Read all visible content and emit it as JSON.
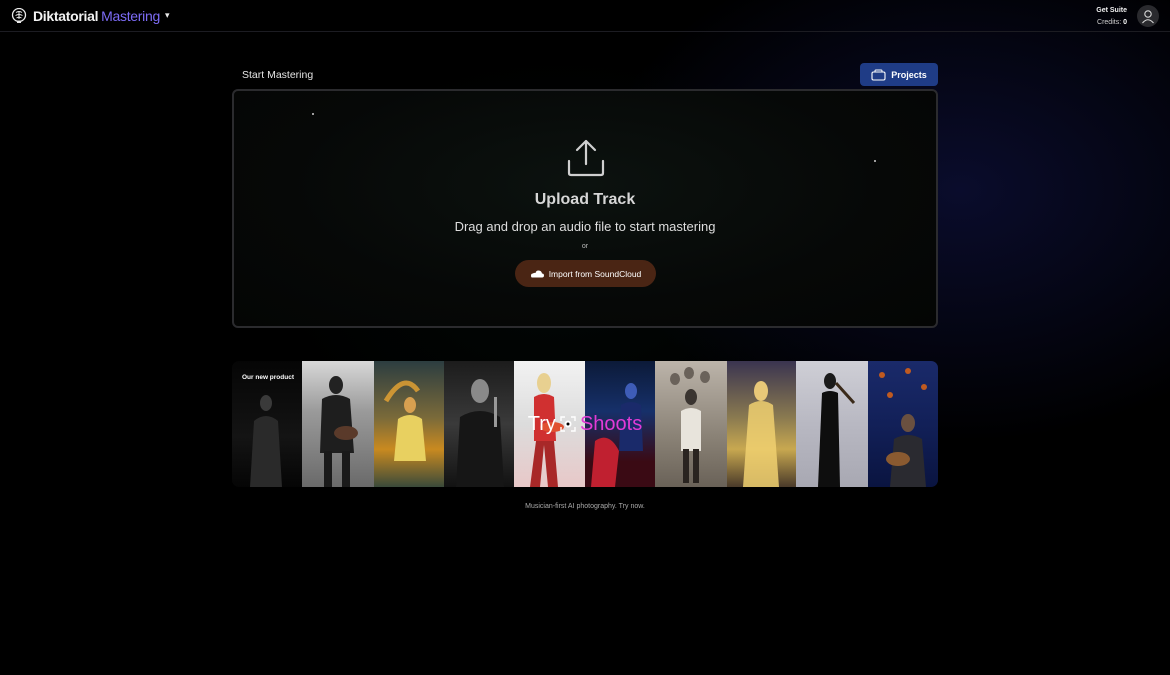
{
  "header": {
    "brand_name": "Diktatorial",
    "brand_product": "Mastering",
    "brand_caret": "▾",
    "get_suite_label": "Get Suite",
    "credits_label": "Credits:",
    "credits_value": "0"
  },
  "page": {
    "title": "Start Mastering",
    "projects_label": "Projects"
  },
  "upload": {
    "title": "Upload Track",
    "subtitle": "Drag and drop an audio file to start mastering",
    "or_text": "or",
    "soundcloud_label": "Import from SoundCloud"
  },
  "banner": {
    "tag": "Our new product",
    "cta_try": "Try",
    "cta_brand": "Shoots",
    "caption": "Musician-first AI photography. Try now."
  },
  "colors": {
    "accent_purple": "#7d6cf6",
    "projects_blue": "#1f3c86",
    "soundcloud_bg": "#4a2514",
    "shoots_pink": "#e23bd6"
  },
  "icons": {
    "brand": "brain-logo-icon",
    "avatar": "user-avatar-icon",
    "projects": "folder-icon",
    "upload": "upload-arrow-icon",
    "soundcloud": "soundcloud-cloud-icon",
    "shoots": "camera-focus-icon"
  }
}
